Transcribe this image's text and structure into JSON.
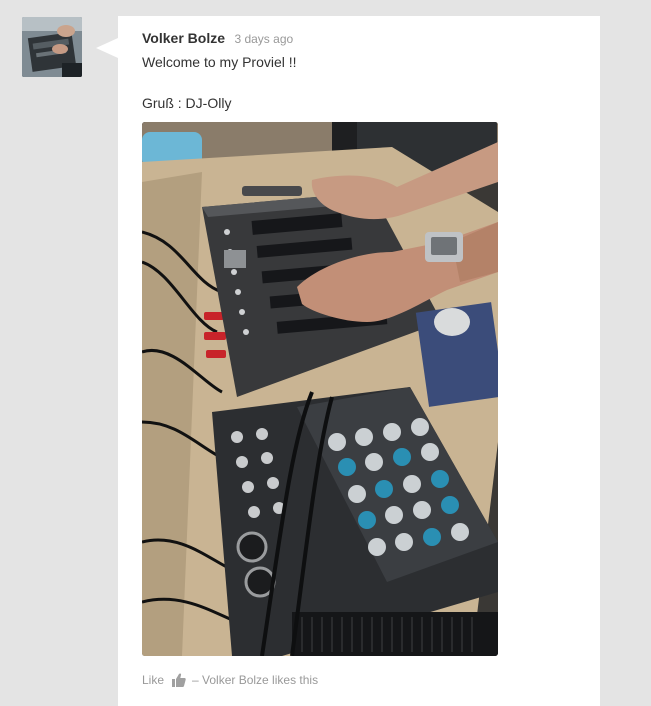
{
  "post": {
    "author": "Volker Bolze",
    "time": "3 days ago",
    "message_line1": "Welcome to my Proviel  !!",
    "message_line2": "Gruß : DJ-Olly",
    "photo_icon": "dj-mixer-photo",
    "avatar_icon": "user-avatar-photo"
  },
  "footer": {
    "like_label": "Like",
    "likes_text": "– Volker Bolze likes this",
    "thumb_icon": "thumbs-up-icon"
  }
}
